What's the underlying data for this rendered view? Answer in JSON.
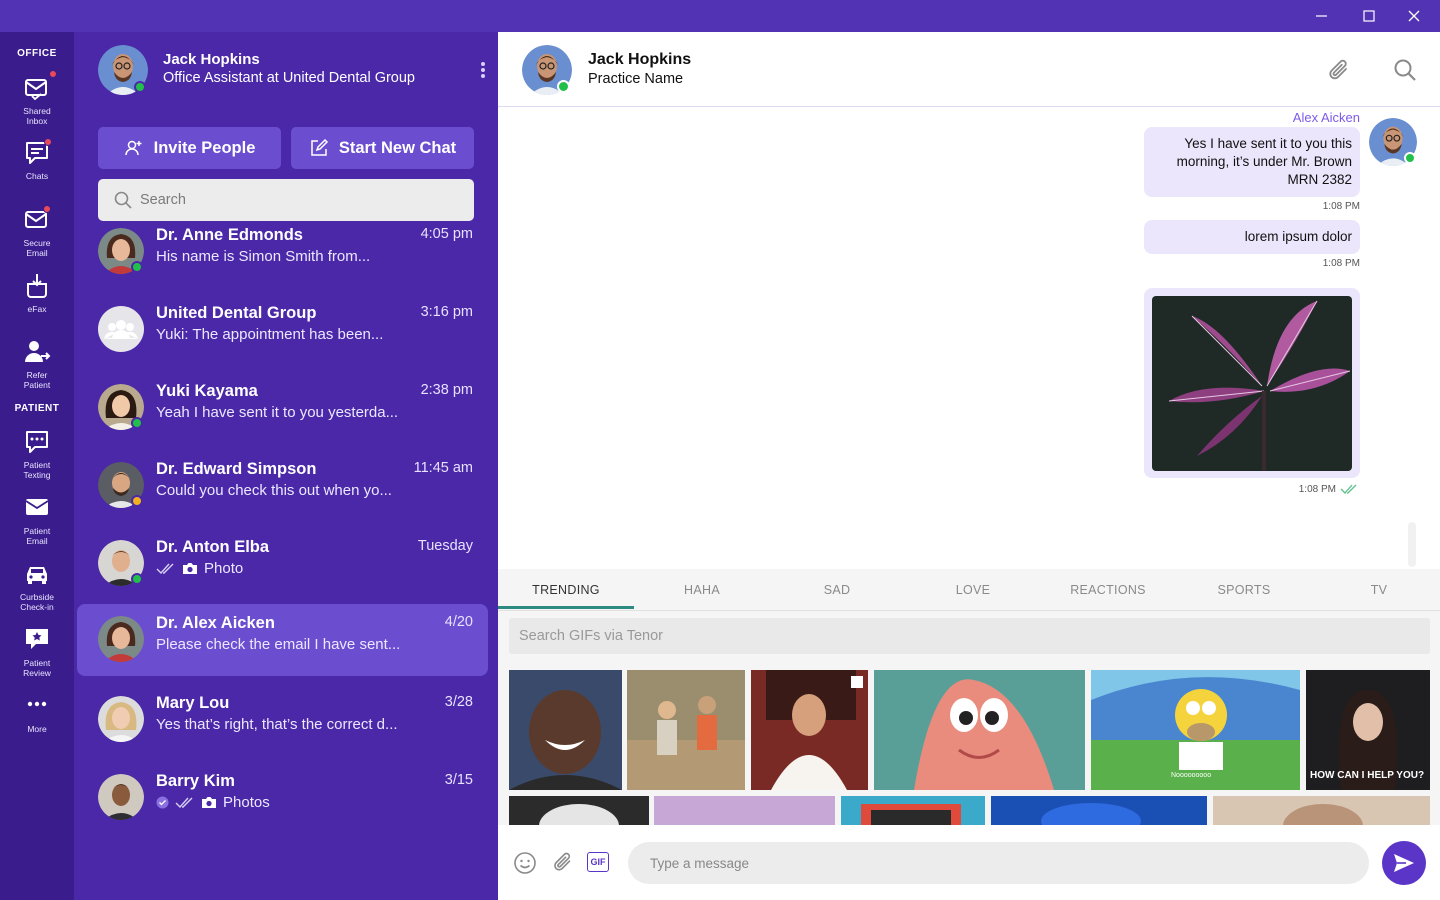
{
  "colors": {
    "titlebar": "#5233b4",
    "rail": "#3a1c8c",
    "list_panel": "#4a28a8",
    "accent": "#6b4ed0",
    "online": "#22c04a",
    "away": "#f2b01e",
    "bubble": "#ebe6fb",
    "tab_underline": "#2d8a80"
  },
  "rail": {
    "office_label": "OFFICE",
    "patient_label": "PATIENT",
    "items": [
      {
        "label": "Shared\nInbox",
        "icon": "shared-inbox-icon"
      },
      {
        "label": "Chats",
        "icon": "chat-icon"
      },
      {
        "label": "Secure\nEmail",
        "icon": "secure-email-icon"
      },
      {
        "label": "eFax",
        "icon": "fax-icon"
      },
      {
        "label": "Refer\nPatient",
        "icon": "refer-patient-icon"
      },
      {
        "label": "Patient\nTexting",
        "icon": "patient-texting-icon"
      },
      {
        "label": "Patient\nEmail",
        "icon": "patient-email-icon"
      },
      {
        "label": "Curbside\nCheck-in",
        "icon": "car-icon"
      },
      {
        "label": "Patient\nReview",
        "icon": "review-icon"
      },
      {
        "label": "More",
        "icon": "more-icon"
      }
    ]
  },
  "me": {
    "name": "Jack Hopkins",
    "title": "Office Assistant at United Dental Group"
  },
  "actions": {
    "invite": "Invite People",
    "new_chat": "Start New Chat"
  },
  "search": {
    "placeholder": "Search"
  },
  "chats": [
    {
      "name": "Dr. Anne Edmonds",
      "time": "4:05 pm",
      "preview": "His name is Simon Smith from..."
    },
    {
      "name": "United Dental Group",
      "time": "3:16 pm",
      "preview": "Yuki: The appointment has been..."
    },
    {
      "name": "Yuki Kayama",
      "time": "2:38 pm",
      "preview": "Yeah I have sent it to you yesterda..."
    },
    {
      "name": "Dr. Edward Simpson",
      "time": "11:45 am",
      "preview": "Could you check this out when yo..."
    },
    {
      "name": "Dr. Anton Elba",
      "time": "Tuesday",
      "preview": "Photo"
    },
    {
      "name": "Dr. Alex Aicken",
      "time": "4/20",
      "preview": "Please check the email I have sent..."
    },
    {
      "name": "Mary Lou",
      "time": "3/28",
      "preview": "Yes that’s right, that’s the correct d..."
    },
    {
      "name": "Barry Kim",
      "time": "3/15",
      "preview": "Photos"
    }
  ],
  "conversation": {
    "name": "Jack Hopkins",
    "subtitle": "Practice Name",
    "sender": "Alex Aicken",
    "messages": [
      {
        "text": "Yes I have sent it to you this\nmorning, it’s under Mr. Brown\nMRN 2382",
        "time": "1:08 PM"
      },
      {
        "text": "lorem ipsum dolor",
        "time": "1:08 PM"
      },
      {
        "text": "",
        "time": "1:08 PM"
      }
    ]
  },
  "gif": {
    "tabs": [
      "TRENDING",
      "HAHA",
      "SAD",
      "LOVE",
      "REACTIONS",
      "SPORTS",
      "TV"
    ],
    "search_placeholder": "Search GIFs via Tenor",
    "caption_help": "HOW CAN I HELP YOU?",
    "caption_homer": "Nooooooooo"
  },
  "composer": {
    "placeholder": "Type a message",
    "gif_label": "GIF"
  }
}
